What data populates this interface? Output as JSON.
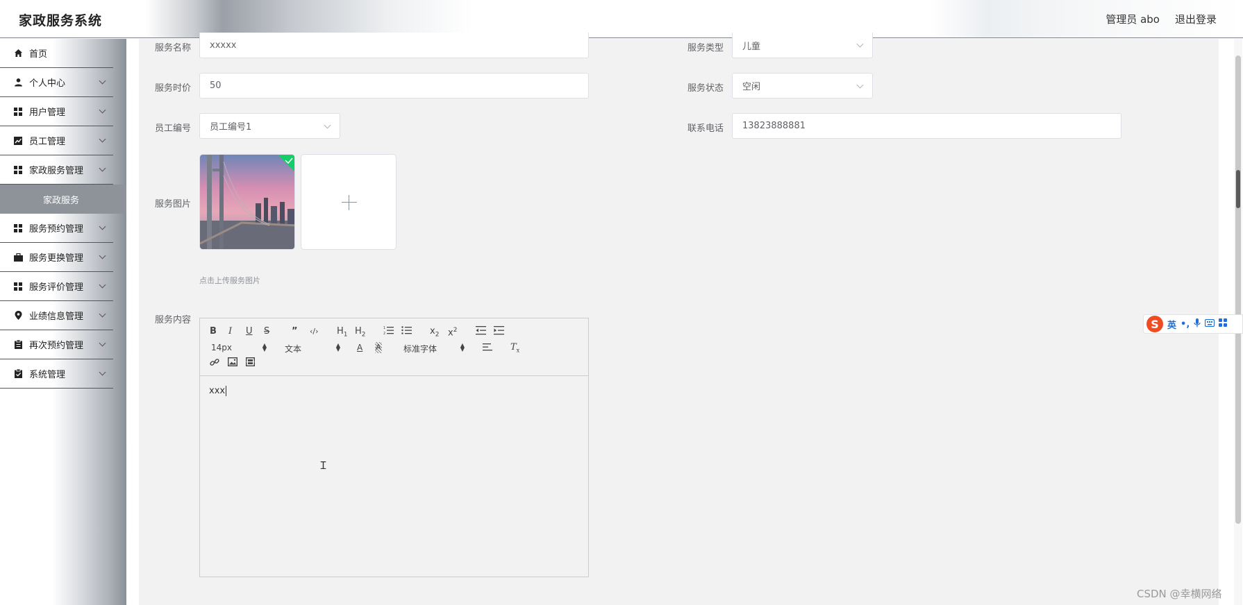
{
  "header": {
    "title": "家政服务系统",
    "user": "管理员 abo",
    "logout": "退出登录"
  },
  "sidebar": {
    "items": [
      {
        "label": "首页",
        "icon": "home-icon",
        "chevron": false
      },
      {
        "label": "个人中心",
        "icon": "user-icon",
        "chevron": true
      },
      {
        "label": "用户管理",
        "icon": "grid-icon",
        "chevron": true
      },
      {
        "label": "员工管理",
        "icon": "chart-icon",
        "chevron": true
      },
      {
        "label": "家政服务管理",
        "icon": "grid-icon",
        "chevron": true
      },
      {
        "label": "服务预约管理",
        "icon": "grid-icon",
        "chevron": true
      },
      {
        "label": "服务更换管理",
        "icon": "briefcase-icon",
        "chevron": true
      },
      {
        "label": "服务评价管理",
        "icon": "grid-icon",
        "chevron": true
      },
      {
        "label": "业绩信息管理",
        "icon": "location-icon",
        "chevron": true
      },
      {
        "label": "再次预约管理",
        "icon": "clipboard-icon",
        "chevron": true
      },
      {
        "label": "系统管理",
        "icon": "clipboard-check-icon",
        "chevron": true
      }
    ],
    "sub_item": "家政服务"
  },
  "form": {
    "service_name": {
      "label": "服务名称",
      "value": "xxxxx"
    },
    "service_type": {
      "label": "服务类型",
      "value": "儿童"
    },
    "service_price": {
      "label": "服务时价",
      "value": "50"
    },
    "service_status": {
      "label": "服务状态",
      "value": "空闲"
    },
    "staff_no": {
      "label": "员工编号",
      "value": "员工编号1"
    },
    "phone": {
      "label": "联系电话",
      "value": "13823888881"
    },
    "image": {
      "label": "服务图片",
      "tip": "点击上传服务图片"
    },
    "content": {
      "label": "服务内容",
      "value": "xxx"
    }
  },
  "editor_toolbar": {
    "size": "14px",
    "header": "文本",
    "font": "标准字体"
  },
  "overlay": {
    "ime_label": "英",
    "watermark": "CSDN @幸横网络"
  }
}
